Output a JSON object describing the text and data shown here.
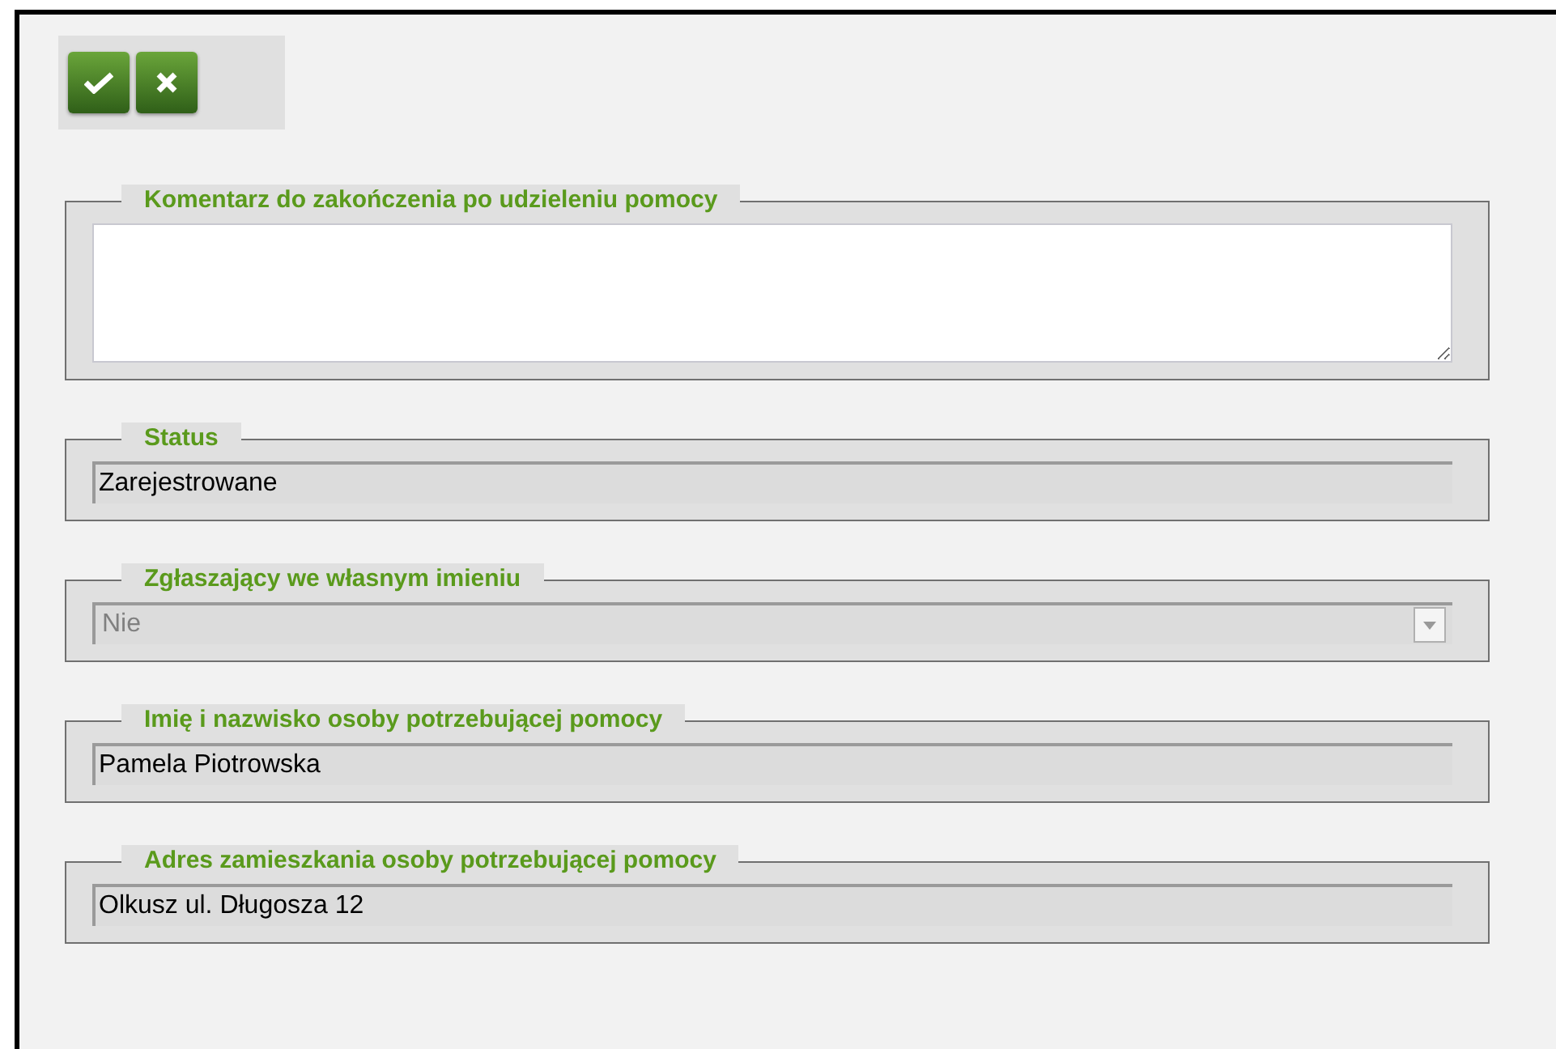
{
  "toolbar": {
    "buttons": [
      {
        "kind": "confirm"
      },
      {
        "kind": "cancel"
      }
    ]
  },
  "fields": [
    {
      "kind": "textarea",
      "legend": "Komentarz do zakończenia po udzieleniu pomocy"
    },
    {
      "kind": "text",
      "legend": "Status",
      "value": "Zarejestrowane"
    },
    {
      "kind": "select",
      "legend": "Zgłaszający we własnym imieniu",
      "value": "Nie",
      "disabled": true
    },
    {
      "kind": "text",
      "legend": "Imię i nazwisko osoby potrzebującej pomocy",
      "value": "Pamela Piotrowska"
    },
    {
      "kind": "text",
      "legend": "Adres zamieszkania osoby potrzebującej pomocy",
      "value": "Olkusz ul. Długosza 12"
    }
  ]
}
